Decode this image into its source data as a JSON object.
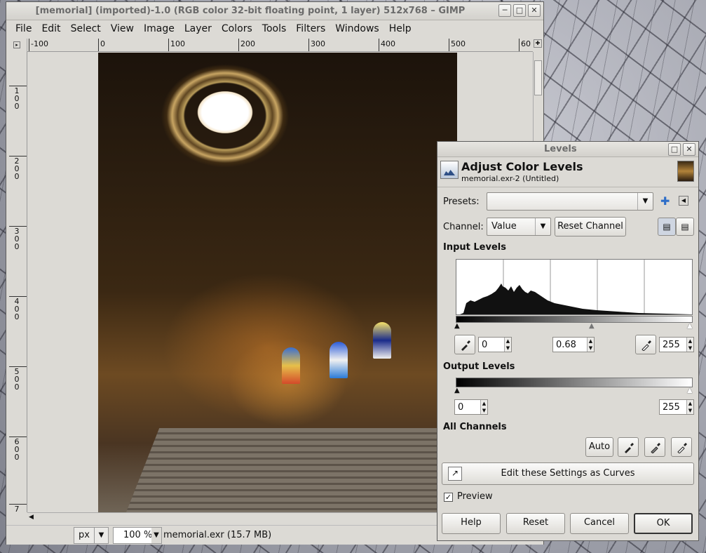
{
  "gimp_window": {
    "title": "[memorial] (imported)-1.0 (RGB color 32-bit floating point, 1 layer) 512x768 – GIMP",
    "controls": {
      "minimize": "─",
      "maximize": "□",
      "close": "✕"
    },
    "menu": [
      "File",
      "Edit",
      "Select",
      "View",
      "Image",
      "Layer",
      "Colors",
      "Tools",
      "Filters",
      "Windows",
      "Help"
    ],
    "ruler_h_labels": [
      "-100",
      "0",
      "100",
      "200",
      "300",
      "400",
      "500",
      "60"
    ],
    "ruler_v_labels": [
      "1\n0\n0",
      "2\n0\n0",
      "3\n0\n0",
      "4\n0\n0",
      "5\n0\n0",
      "6\n0\n0",
      "7"
    ],
    "status": {
      "unit": "px",
      "zoom": "100 %",
      "file_info": "memorial.exr (15.7 MB)"
    }
  },
  "levels_dialog": {
    "window_title": "Levels",
    "heading": "Adjust Color Levels",
    "subtitle": "memorial.exr-2 (Untitled)",
    "presets_label": "Presets:",
    "presets_value": "",
    "channel_label": "Channel:",
    "channel_value": "Value",
    "reset_channel": "Reset Channel",
    "input_levels_title": "Input Levels",
    "input_low": "0",
    "input_gamma": "0.68",
    "input_high": "255",
    "output_levels_title": "Output Levels",
    "output_low": "0",
    "output_high": "255",
    "all_channels_title": "All Channels",
    "auto_button": "Auto",
    "edit_curves_button": "Edit these Settings as Curves",
    "preview_label": "Preview",
    "preview_checked": true,
    "buttons": {
      "help": "Help",
      "reset": "Reset",
      "cancel": "Cancel",
      "ok": "OK"
    },
    "accent_color": "#2e4f86"
  }
}
